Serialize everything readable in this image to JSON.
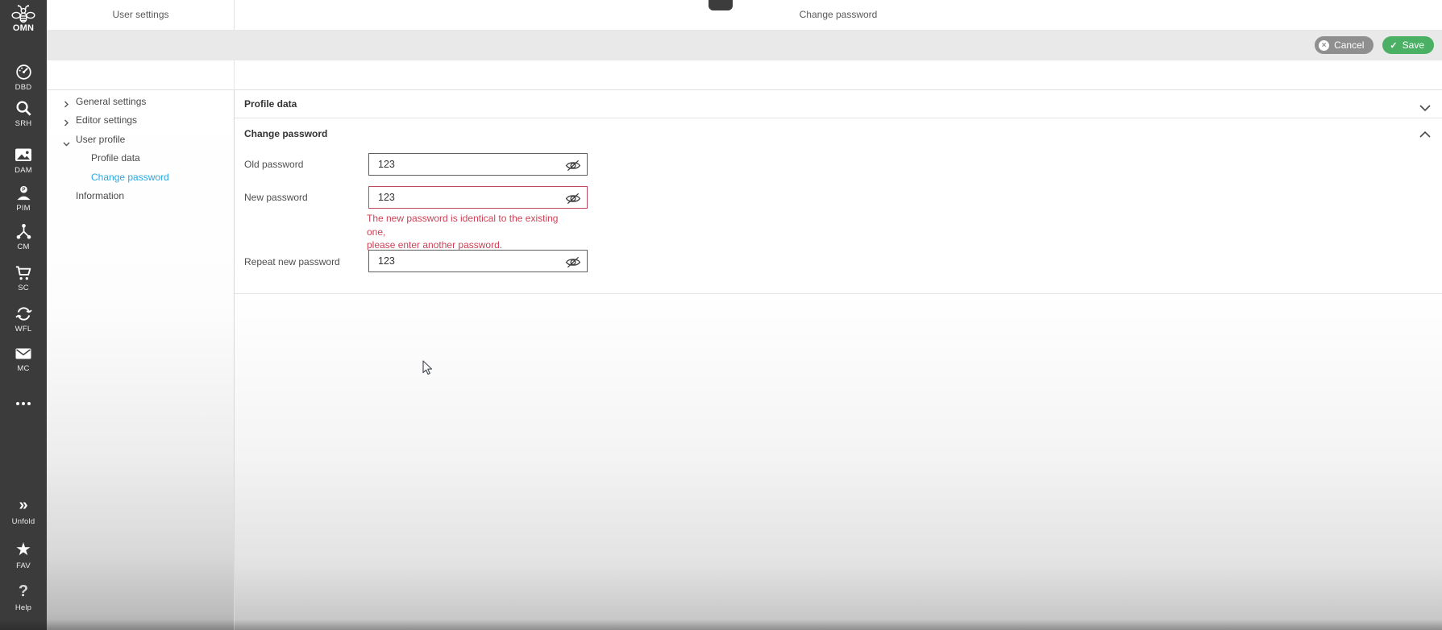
{
  "topbar": {
    "sidebar_title": "User settings",
    "page_title": "Change password"
  },
  "toolbar": {
    "cancel_label": "Cancel",
    "save_label": "Save"
  },
  "rail": {
    "logo": {
      "label": "OMN",
      "icon": "bee-icon"
    },
    "items": [
      {
        "label": "DBD",
        "icon": "dashboard-icon"
      },
      {
        "label": "SRH",
        "icon": "search-icon"
      },
      {
        "label": "DAM",
        "icon": "image-icon"
      },
      {
        "label": "PIM",
        "icon": "person-icon"
      },
      {
        "label": "CM",
        "icon": "share-icon"
      },
      {
        "label": "SC",
        "icon": "cart-icon"
      },
      {
        "label": "WFL",
        "icon": "sync-icon"
      },
      {
        "label": "MC",
        "icon": "mail-icon"
      }
    ],
    "more_icon": "ellipsis-icon",
    "bottom": [
      {
        "label": "Unfold",
        "icon": "double-chevron-right-icon"
      },
      {
        "label": "FAV",
        "icon": "star-icon"
      },
      {
        "label": "Help",
        "icon": "question-icon"
      }
    ]
  },
  "tree": {
    "items": [
      {
        "label": "General settings",
        "state": "collapsed"
      },
      {
        "label": "Editor settings",
        "state": "collapsed"
      },
      {
        "label": "User profile",
        "state": "expanded"
      },
      {
        "label": "Profile data",
        "child": true
      },
      {
        "label": "Change password",
        "child": true,
        "selected": true
      },
      {
        "label": "Information"
      }
    ]
  },
  "main": {
    "sections": [
      {
        "title": "Profile data",
        "expanded": false
      },
      {
        "title": "Change password",
        "expanded": true
      }
    ],
    "form": {
      "fields": [
        {
          "label": "Old password",
          "value": "123",
          "error": false
        },
        {
          "label": "New password",
          "value": "123",
          "error": true
        },
        {
          "label": "Repeat new password",
          "value": "123",
          "error": false
        }
      ],
      "error_line1": "The new password is identical to the existing one,",
      "error_line2": "please enter another password."
    }
  },
  "colors": {
    "rail_bg": "#3b3b3b",
    "toolbar_bg": "#e9e9e9",
    "accent_blue": "#2ba7e0",
    "save_green": "#4ab164",
    "cancel_gray": "#8f8f8f",
    "error_red": "#cc4257",
    "input_border": "#5f5f5f",
    "divider": "#e3e3e3"
  }
}
